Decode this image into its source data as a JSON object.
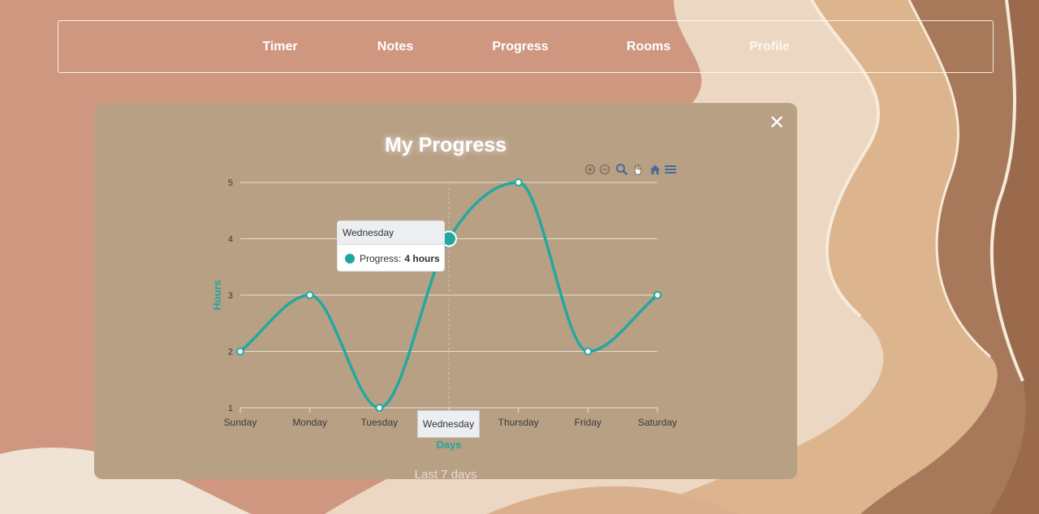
{
  "nav": {
    "items": [
      {
        "label": "Timer"
      },
      {
        "label": "Notes"
      },
      {
        "label": "Progress"
      },
      {
        "label": "Rooms"
      },
      {
        "label": "Profile"
      }
    ]
  },
  "card": {
    "title": "My Progress",
    "footer": "Last 7 days",
    "close_icon": "close-icon"
  },
  "toolbar": {
    "icons": [
      "zoom-in-icon",
      "zoom-out-icon",
      "zoom-selection-icon",
      "pan-hand-icon",
      "reset-home-icon",
      "menu-icon"
    ]
  },
  "tooltip": {
    "title": "Wednesday",
    "series_label": "Progress:",
    "value_text": "4 hours"
  },
  "crosshair_label": "Wednesday",
  "colors": {
    "background": "#cf9780",
    "card": "#b8a085",
    "series": "#22a8a0",
    "axis_title": "#1fa6a0"
  },
  "chart_data": {
    "type": "line",
    "curve": "smooth",
    "categories": [
      "Sunday",
      "Monday",
      "Tuesday",
      "Wednesday",
      "Thursday",
      "Friday",
      "Saturday"
    ],
    "series": [
      {
        "name": "Progress",
        "values": [
          2,
          3,
          1,
          4,
          5,
          2,
          3
        ]
      }
    ],
    "xlabel": "Days",
    "ylabel": "Hours",
    "ylim": [
      1,
      5
    ],
    "yticks": [
      "1",
      "2",
      "3",
      "4",
      "5"
    ],
    "grid": true,
    "highlighted_category": "Wednesday"
  }
}
